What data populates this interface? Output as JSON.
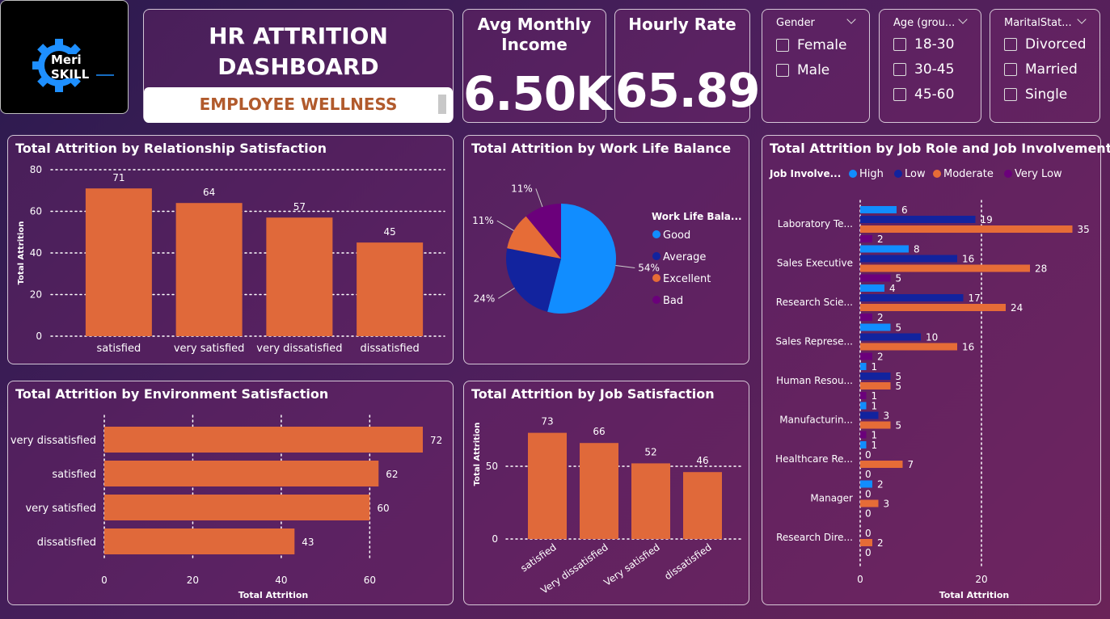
{
  "logo": {
    "line1": "Meri",
    "line2": "SKILL"
  },
  "header": {
    "title_line1": "HR ATTRITION",
    "title_line2": "DASHBOARD",
    "subtitle": "EMPLOYEE WELLNESS"
  },
  "kpis": {
    "avg_income_label_1": "Avg Monthly",
    "avg_income_label_2": "Income",
    "avg_income_value": "6.50K",
    "hourly_rate_label": "Hourly Rate",
    "hourly_rate_value": "65.89"
  },
  "slicers": {
    "gender": {
      "title": "Gender",
      "options": [
        "Female",
        "Male"
      ]
    },
    "age": {
      "title": "Age (grou...",
      "options": [
        "18-30",
        "30-45",
        "45-60"
      ]
    },
    "marital": {
      "title": "MaritalStat...",
      "options": [
        "Divorced",
        "Married",
        "Single"
      ]
    }
  },
  "colors": {
    "orange": "#e0693a",
    "good": "#118dff",
    "average": "#12239e",
    "excellent": "#e66c37",
    "bad": "#6b007b"
  },
  "chart_data": [
    {
      "id": "relationship",
      "type": "bar",
      "title": "Total Attrition by Relationship Satisfaction",
      "ylabel": "Total Attrition",
      "xlabel": "",
      "ylim": [
        0,
        80
      ],
      "yticks": [
        0,
        20,
        40,
        60,
        80
      ],
      "categories": [
        "satisfied",
        "very satisfied",
        "very dissatisfied",
        "dissatisfied"
      ],
      "values": [
        71,
        64,
        57,
        45
      ]
    },
    {
      "id": "worklife",
      "type": "pie",
      "title": "Total Attrition by Work Life Balance",
      "legend_title": "Work Life Bala...",
      "labels": [
        "Good",
        "Average",
        "Excellent",
        "Bad"
      ],
      "percent": [
        54,
        24,
        11,
        11
      ],
      "percent_labels": [
        "54%",
        "24%",
        "11%",
        "11%"
      ]
    },
    {
      "id": "jobrole",
      "type": "bar",
      "orientation": "horizontal",
      "title": "Total Attrition by Job Role and Job Involvement",
      "legend_title": "Job Involve...",
      "xlabel": "Total Attrition",
      "xticks": [
        0,
        20
      ],
      "xlim": [
        0,
        40
      ],
      "categories": [
        "Laboratory Te...",
        "Sales Executive",
        "Research Scie...",
        "Sales Represe...",
        "Human Resou...",
        "Manufacturin...",
        "Healthcare Re...",
        "Manager",
        "Research Dire..."
      ],
      "series": [
        {
          "name": "High",
          "values": [
            6,
            8,
            4,
            5,
            1,
            1,
            1,
            2,
            null
          ]
        },
        {
          "name": "Low",
          "values": [
            19,
            16,
            17,
            10,
            5,
            3,
            0,
            0,
            0
          ]
        },
        {
          "name": "Moderate",
          "values": [
            35,
            28,
            24,
            16,
            5,
            5,
            7,
            3,
            2
          ]
        },
        {
          "name": "Very Low",
          "values": [
            2,
            5,
            2,
            2,
            1,
            1,
            0,
            0,
            0
          ]
        }
      ]
    },
    {
      "id": "environment",
      "type": "bar",
      "orientation": "horizontal",
      "title": "Total Attrition by Environment Satisfaction",
      "xlabel": "Total Attrition",
      "xlim": [
        0,
        72
      ],
      "xticks": [
        0,
        20,
        40,
        60
      ],
      "categories": [
        "very dissatisfied",
        "satisfied",
        "very satisfied",
        "dissatisfied"
      ],
      "values": [
        72,
        62,
        60,
        43
      ]
    },
    {
      "id": "jobsat",
      "type": "bar",
      "title": "Total Attrition by Job Satisfaction",
      "ylabel": "Total Attrition",
      "ylim": [
        0,
        100
      ],
      "yticks": [
        0,
        50
      ],
      "categories": [
        "satisfied",
        "Very dissatisfied",
        "Very satisfied",
        "dissatisfied"
      ],
      "values": [
        73,
        66,
        52,
        46
      ]
    }
  ]
}
